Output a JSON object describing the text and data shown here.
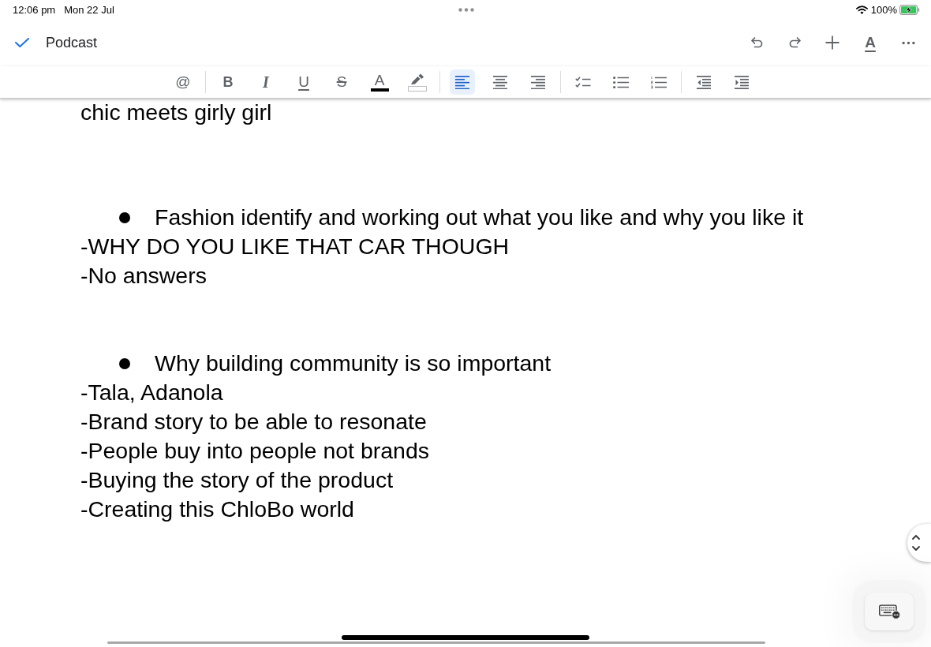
{
  "status_bar": {
    "time": "12:06 pm",
    "date": "Mon 22 Jul",
    "battery": "100%",
    "charging": true
  },
  "header": {
    "title": "Podcast",
    "actions": [
      {
        "kind": "undo"
      },
      {
        "kind": "redo"
      },
      {
        "kind": "insert"
      },
      {
        "kind": "text_format",
        "label": "A"
      },
      {
        "kind": "more"
      }
    ]
  },
  "format_toolbar": {
    "groups": [
      {
        "tools": [
          {
            "kind": "mention",
            "label": "@"
          }
        ]
      },
      {
        "tools": [
          {
            "kind": "bold",
            "label": "B"
          },
          {
            "kind": "italic",
            "label": "I"
          },
          {
            "kind": "underline",
            "label": "U"
          },
          {
            "kind": "strikethrough",
            "label": "S"
          },
          {
            "kind": "text_color",
            "label": "A",
            "color": "#000000"
          },
          {
            "kind": "highlight",
            "color": "#ffffff"
          }
        ]
      },
      {
        "tools": [
          {
            "kind": "align_left",
            "selected": true
          },
          {
            "kind": "align_center",
            "selected": false
          },
          {
            "kind": "align_right",
            "selected": false
          }
        ]
      },
      {
        "tools": [
          {
            "kind": "checklist"
          },
          {
            "kind": "bulleted_list"
          },
          {
            "kind": "numbered_list"
          }
        ]
      },
      {
        "tools": [
          {
            "kind": "decrease_indent"
          },
          {
            "kind": "increase_indent"
          }
        ]
      }
    ]
  },
  "document": {
    "partial_line": "chic meets girly girl",
    "sections": [
      {
        "bullet": "Fashion identify and working out what you like and why you like it",
        "lines": [
          "-WHY DO YOU LIKE THAT CAR THOUGH",
          "-No answers"
        ]
      },
      {
        "bullet": "Why building community is so important",
        "lines": [
          "-Tala, Adanola",
          "-Brand story to be able to resonate",
          "-People buy into people not brands",
          "-Buying the story of the product",
          "-Creating this ChloBo world"
        ]
      }
    ]
  }
}
